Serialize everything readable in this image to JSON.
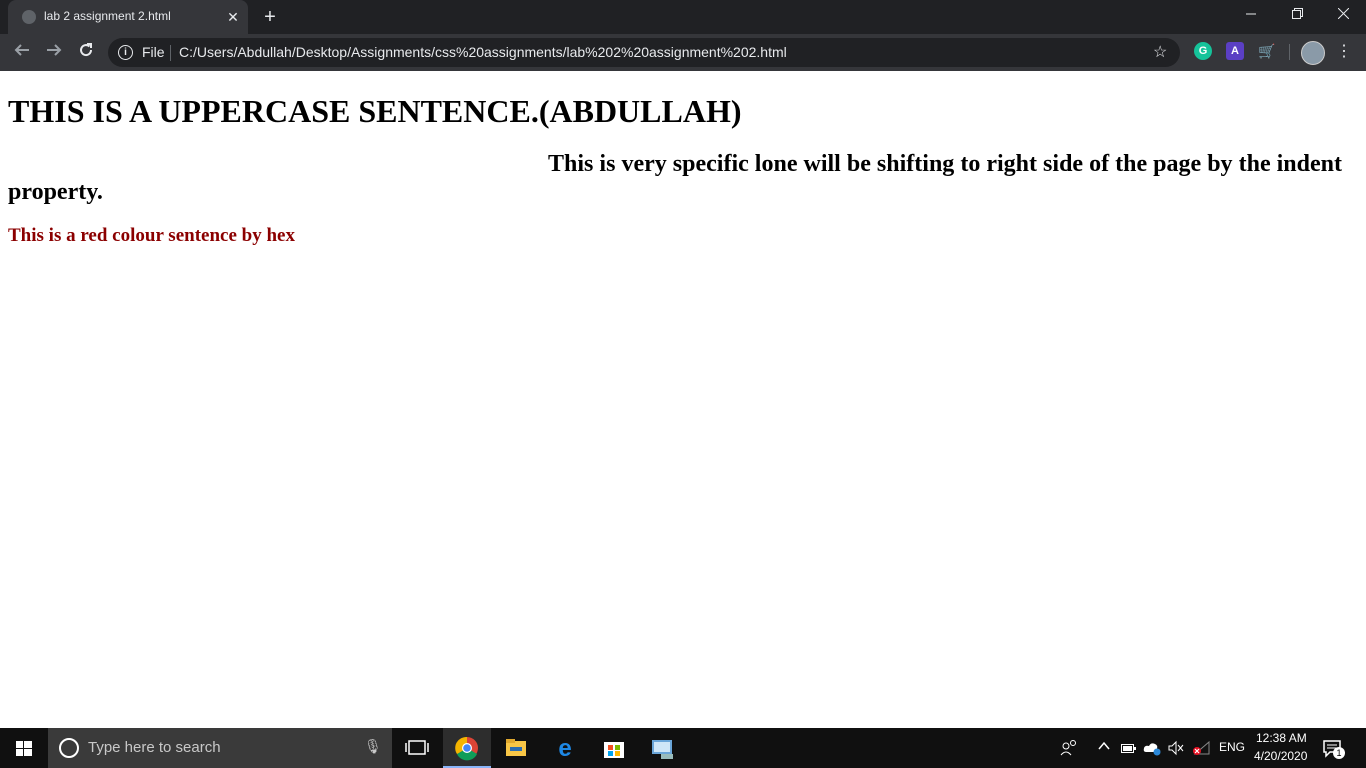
{
  "browser": {
    "tab_title": "lab 2 assignment 2.html",
    "file_label": "File",
    "url": "C:/Users/Abdullah/Desktop/Assignments/css%20assignments/lab%202%20assignment%202.html",
    "extensions": {
      "grammarly_letter": "G",
      "ext_a_letter": "A"
    }
  },
  "page": {
    "heading": "THIS IS A UPPERCASE SENTENCE.(ABDULLAH)",
    "indent_paragraph": "This is very specific lone will be shifting to right side of the page by the indent property.",
    "red_line": "This is a red colour sentence by hex"
  },
  "taskbar": {
    "search_placeholder": "Type here to search",
    "language": "ENG",
    "time": "12:38 AM",
    "date": "4/20/2020",
    "notification_count": "1"
  }
}
